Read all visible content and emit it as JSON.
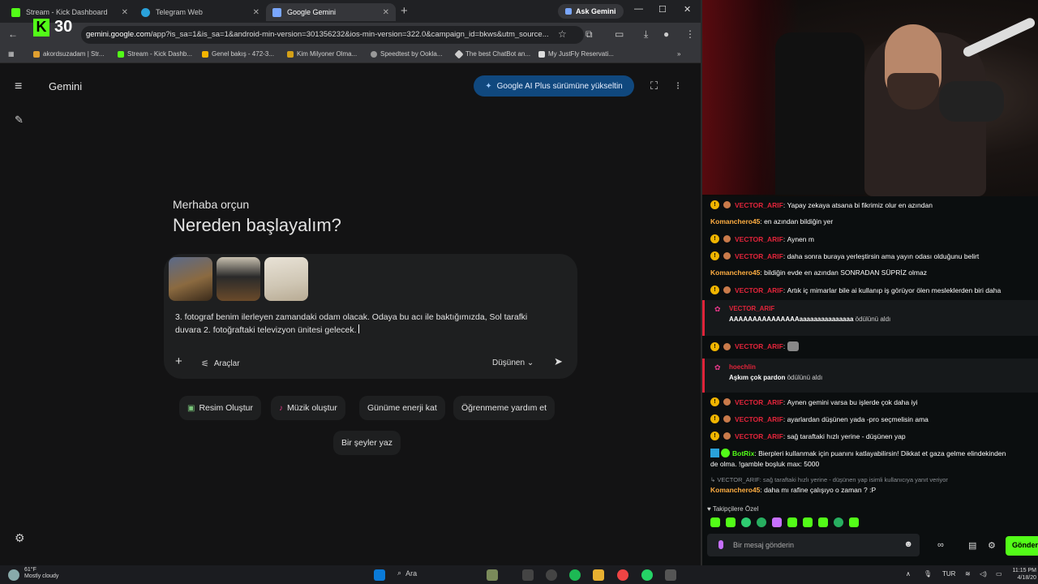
{
  "browser": {
    "tabs": [
      {
        "label": "Stream - Kick Dashboard",
        "favicon_color": "#53fc18"
      },
      {
        "label": "Telegram Web",
        "favicon_color": "#2aa1da"
      },
      {
        "label": "Google Gemini",
        "favicon_color": "#7aa7ff"
      }
    ],
    "ask_gemini": "Ask Gemini",
    "overlay_counter": "30",
    "url": {
      "domain": "gemini.google.com",
      "path": "/app?is_sa=1&is_sa=1&android-min-version=301356232&ios-min-version=322.0&campaign_id=bkws&utm_source..."
    },
    "bookmarks": [
      {
        "label": "akordsuzadam | Str...",
        "color": "#e0a030"
      },
      {
        "label": "Stream - Kick Dashb...",
        "color": "#53fc18"
      },
      {
        "label": "Genel bakış - 472-3...",
        "color": "#f4b400"
      },
      {
        "label": "Kim Milyoner Olma...",
        "color": "#d4a017"
      },
      {
        "label": "Speedtest by Ookla...",
        "color": "#999999"
      },
      {
        "label": "The best ChatBot an...",
        "color": "#cccccc"
      },
      {
        "label": "My JustFly Reservati...",
        "color": "#dddddd"
      }
    ]
  },
  "gemini": {
    "title": "Gemini",
    "upgrade_label": "Google AI Plus sürümüne yükseltin",
    "greeting": "Merhaba orçun",
    "headline": "Nereden başlayalım?",
    "prompt_line1": "3. fotograf benim ilerleyen zamandaki odam olacak. Odaya bu acı ile baktığımızda, Sol tarafki",
    "prompt_line2": "duvara 2. fotoğraftaki televizyon ünitesi gelecek.",
    "tools_label": "Araçlar",
    "mode_label": "Düşünen",
    "chips": [
      {
        "label": "Resim Oluştur",
        "icon": "🖼"
      },
      {
        "label": "Müzik oluştur",
        "icon": "🎸"
      },
      {
        "label": "Günüme enerji kat",
        "icon": ""
      },
      {
        "label": "Öğrenmeme yardım et",
        "icon": ""
      },
      {
        "label": "Bir şeyler yaz",
        "icon": ""
      }
    ]
  },
  "chat": {
    "messages": [
      {
        "user": "VECTOR_ARIF",
        "text": "Yapay zekaya atsana bi fikrimiz olur en azından",
        "badges": true
      },
      {
        "user": "Komanchero45",
        "text": "en azından bildiğin yer",
        "badges": false
      },
      {
        "user": "VECTOR_ARIF",
        "text": "Aynen m",
        "badges": true
      },
      {
        "user": "VECTOR_ARIF",
        "text": "daha sonra buraya yerleştirsin ama yayın odası olduğunu belirt",
        "badges": true
      },
      {
        "user": "Komanchero45",
        "text": "bildiğin evde en azından SONRADAN SÜPRİZ olmaz",
        "badges": false
      },
      {
        "user": "VECTOR_ARIF",
        "text": "Artık iç mimarlar bile ai kullanıp iş görüyor ölen mesleklerden biri daha",
        "badges": true
      }
    ],
    "redeem1": {
      "user": "VECTOR_ARIF",
      "text": "AAAAAAAAAAAAAAAaaaaaaaaaaaaaaa",
      "suffix": "ödülünü aldı"
    },
    "msg_emote_user": "VECTOR_ARIF",
    "redeem2": {
      "user": "hoechlin",
      "text": "Aşkım çok pardon",
      "suffix": "ödülünü aldı"
    },
    "messages2": [
      {
        "user": "VECTOR_ARIF",
        "text": "Aynen gemini varsa bu işlerde çok daha iyi"
      },
      {
        "user": "VECTOR_ARIF",
        "text": "ayarlardan düşünen yada -pro seçmelisin ama"
      },
      {
        "user": "VECTOR_ARIF",
        "text": "sağ taraftaki hızlı yerine - düşünen yap"
      }
    ],
    "botrix": {
      "user": "BotRix",
      "line1": "Bierpleri kullanmak için puanını katlayabilirsin! Dikkat et gaza gelme elindekinden",
      "line2": "de olma. !gamble boşluk max: 5000"
    },
    "reply_ref": "↳ VECTOR_ARIF: sağ taraftaki hızlı yerine - düşünen yap isimli kullanıcıya yanıt veriyor",
    "last": {
      "user": "Komanchero45",
      "text": "daha mı rafine çalışıyo o zaman ? :P"
    },
    "followers_label": "Takipçilere Özel",
    "input_placeholder": "Bir mesaj gönderin",
    "send_label": "Gönder"
  },
  "taskbar": {
    "temp": "61°F",
    "weather": "Mostly cloudy",
    "search": "Ara",
    "lang": "TUR",
    "time": "11:15 PM",
    "date": "4/18/20"
  },
  "colors": {
    "kick_green": "#53fc18",
    "gemini_bg": "#131314",
    "upgrade_blue": "#10487e",
    "username_red": "#e0243a",
    "username_orange": "#ffae42"
  }
}
